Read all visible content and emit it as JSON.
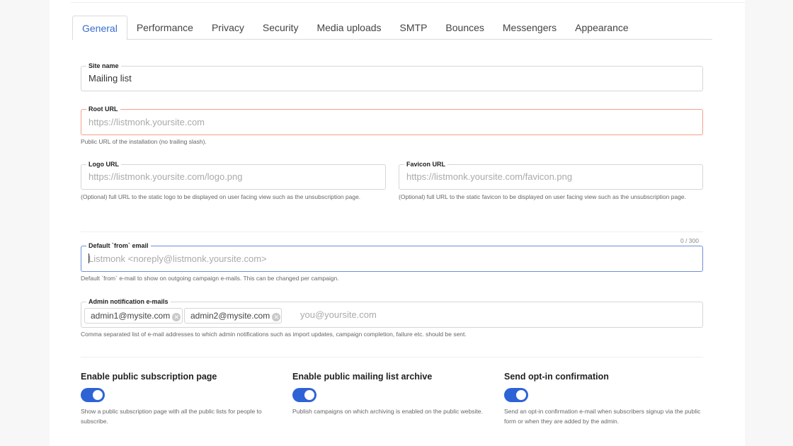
{
  "tabs": [
    "General",
    "Performance",
    "Privacy",
    "Security",
    "Media uploads",
    "SMTP",
    "Bounces",
    "Messengers",
    "Appearance"
  ],
  "site_name": {
    "label": "Site name",
    "value": "Mailing list"
  },
  "root_url": {
    "label": "Root URL",
    "placeholder": "https://listmonk.yoursite.com",
    "help": "Public URL of the installation (no trailing slash)."
  },
  "logo_url": {
    "label": "Logo URL",
    "placeholder": "https://listmonk.yoursite.com/logo.png",
    "help": "(Optional) full URL to the static logo to be displayed on user facing view such as the unsubscription page."
  },
  "favicon_url": {
    "label": "Favicon URL",
    "placeholder": "https://listmonk.yoursite.com/favicon.png",
    "help": "(Optional) full URL to the static favicon to be displayed on user facing view such as the unsubscription page."
  },
  "from_email": {
    "label": "Default `from` email",
    "placeholder": "Listmonk <noreply@listmonk.yoursite.com>",
    "counter": "0 / 300",
    "help": "Default `from` e-mail to show on outgoing campaign e-mails. This can be changed per campaign."
  },
  "admin_emails": {
    "label": "Admin notification e-mails",
    "tags": [
      "admin1@mysite.com",
      "admin2@mysite.com"
    ],
    "placeholder": "you@yoursite.com",
    "help": "Comma separated list of e-mail addresses to which admin notifications such as import updates, campaign completion, failure etc. should be sent."
  },
  "switches": [
    {
      "title": "Enable public subscription page",
      "on": true,
      "help": "Show a public subscription page with all the public lists for people to subscribe."
    },
    {
      "title": "Enable public mailing list archive",
      "on": true,
      "help": "Publish campaigns on which archiving is enabled on the public website."
    },
    {
      "title": "Send opt-in confirmation",
      "on": true,
      "help": "Send an opt-in confirmation e-mail when subscribers signup via the public form or when they are added by the admin."
    }
  ],
  "colors": {
    "accent": "#2e63d6",
    "tab_active": "#3a6cd1",
    "error_border": "#f0a08a",
    "focus_border": "#6d8fd9"
  }
}
